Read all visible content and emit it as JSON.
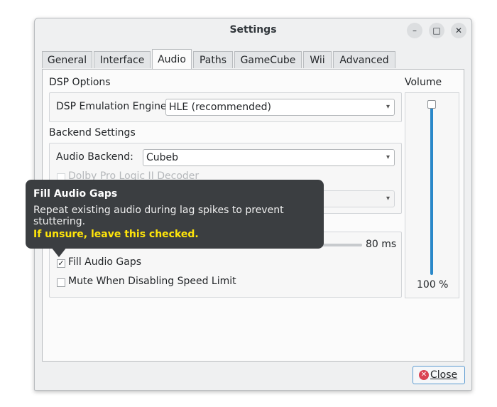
{
  "window": {
    "title": "Settings"
  },
  "title_buttons": {
    "minimize": "–",
    "maximize": "□",
    "close": "✕"
  },
  "tabs": [
    {
      "label": "General"
    },
    {
      "label": "Interface"
    },
    {
      "label": "Audio"
    },
    {
      "label": "Paths"
    },
    {
      "label": "GameCube"
    },
    {
      "label": "Wii"
    },
    {
      "label": "Advanced"
    }
  ],
  "active_tab": "Audio",
  "dsp": {
    "heading": "DSP Options",
    "engine_label": "DSP Emulation Engine:",
    "engine_value": "HLE (recommended)"
  },
  "backend": {
    "heading": "Backend Settings",
    "backend_label": "Audio Backend:",
    "backend_value": "Cubeb",
    "dolby_label": "Dolby Pro Logic II Decoder"
  },
  "stretch": {
    "value_text": "80 ms",
    "fill_gaps_label": "Fill Audio Gaps",
    "fill_gaps_checked": true,
    "mute_label": "Mute When Disabling Speed Limit",
    "mute_checked": false
  },
  "volume": {
    "heading": "Volume",
    "value_text": "100 %",
    "level_percent": 100
  },
  "buttons": {
    "close_label": "Close"
  },
  "tooltip": {
    "title": "Fill Audio Gaps",
    "description": "Repeat existing audio during lag spikes to prevent stuttering.",
    "warning": "If unsure, leave this checked."
  },
  "colors": {
    "accent": "#2a88c9",
    "tooltip_bg": "#3b3e41",
    "tooltip_warning": "#ffe50a",
    "close_icon": "#da4453"
  }
}
